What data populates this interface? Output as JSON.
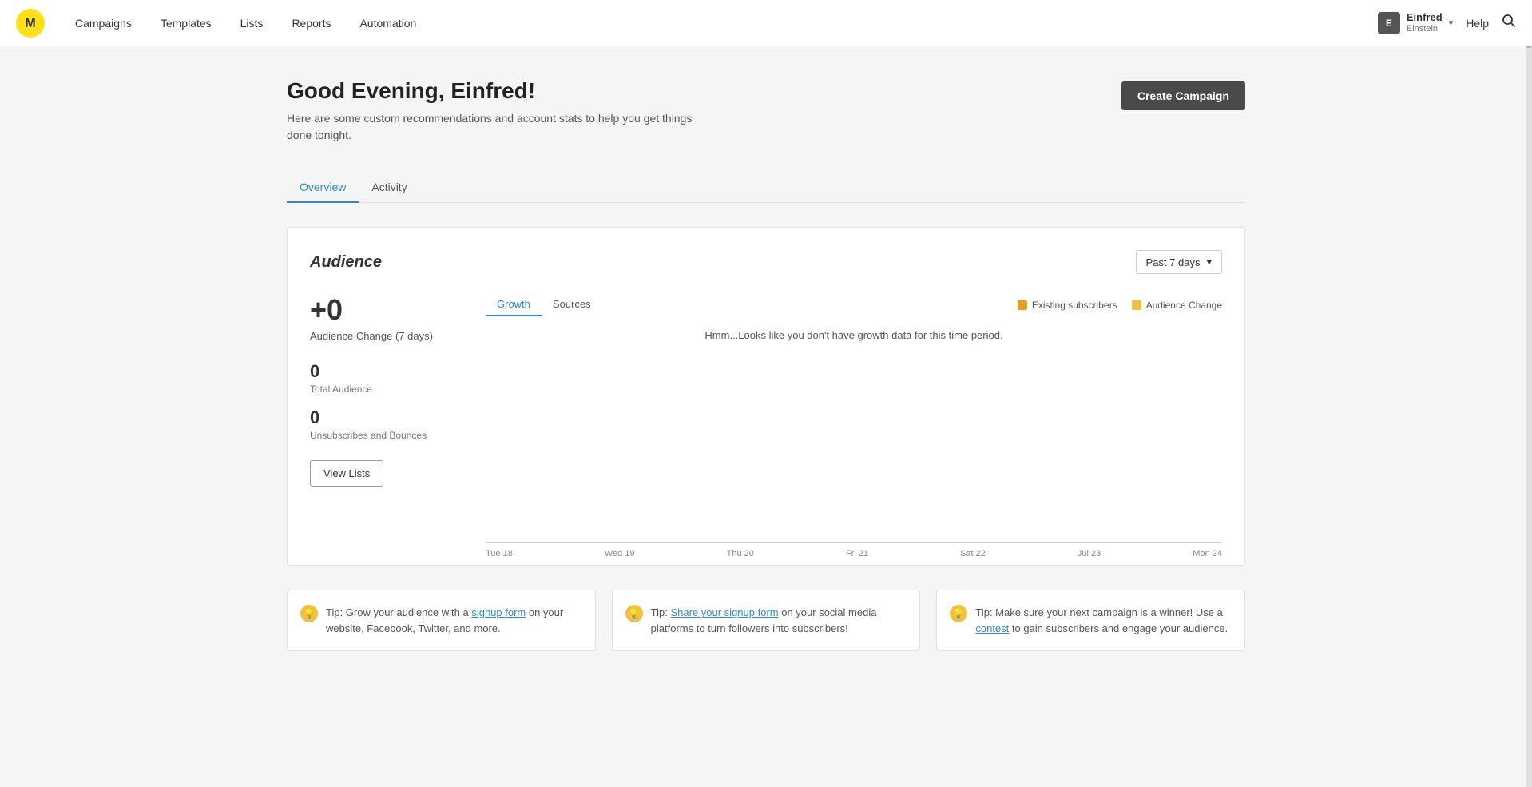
{
  "nav": {
    "logo_alt": "Mailchimp",
    "links": [
      {
        "label": "Campaigns",
        "name": "campaigns"
      },
      {
        "label": "Templates",
        "name": "templates"
      },
      {
        "label": "Lists",
        "name": "lists"
      },
      {
        "label": "Reports",
        "name": "reports"
      },
      {
        "label": "Automation",
        "name": "automation"
      }
    ],
    "user": {
      "avatar": "E",
      "name": "Einfred",
      "sub": "Einstein",
      "chevron": "▾"
    },
    "help": "Help",
    "search_icon": "🔍"
  },
  "header": {
    "greeting": "Good Evening, Einfred!",
    "subtitle": "Here are some custom recommendations and account stats to help you get things done tonight.",
    "create_campaign_label": "Create Campaign"
  },
  "tabs": [
    {
      "label": "Overview",
      "active": true
    },
    {
      "label": "Activity",
      "active": false
    }
  ],
  "audience": {
    "title": "Audience",
    "period_label": "Past 7 days",
    "audience_change_val": "+0",
    "audience_change_label": "Audience Change (7 days)",
    "stats": [
      {
        "val": "0",
        "label": "Total Audience"
      },
      {
        "val": "0",
        "label": "Unsubscribes and Bounces"
      }
    ],
    "view_lists_label": "View Lists",
    "chart": {
      "tabs": [
        {
          "label": "Growth",
          "active": true
        },
        {
          "label": "Sources",
          "active": false
        }
      ],
      "legend": [
        {
          "label": "Existing subscribers",
          "color": "#e0a020"
        },
        {
          "label": "Audience Change",
          "color": "#f0c040"
        }
      ],
      "no_data_msg": "Hmm...Looks like you don't have growth data for this time period.",
      "x_labels": [
        "Tue 18",
        "Wed 19",
        "Thu 20",
        "Fri 21",
        "Sat 22",
        "Jul 23",
        "Mon 24"
      ]
    }
  },
  "tips": [
    {
      "prefix": "Tip: Grow your audience with a ",
      "link_text": "signup form",
      "suffix": " on your website, Facebook, Twitter, and more."
    },
    {
      "prefix": "Tip: ",
      "link_text": "Share your signup form",
      "suffix": " on your social media platforms to turn followers into subscribers!"
    },
    {
      "prefix": "Tip: Make sure your next campaign is a winner! Use a ",
      "link_text": "contest",
      "suffix": " to gain subscribers and engage your audience."
    }
  ]
}
